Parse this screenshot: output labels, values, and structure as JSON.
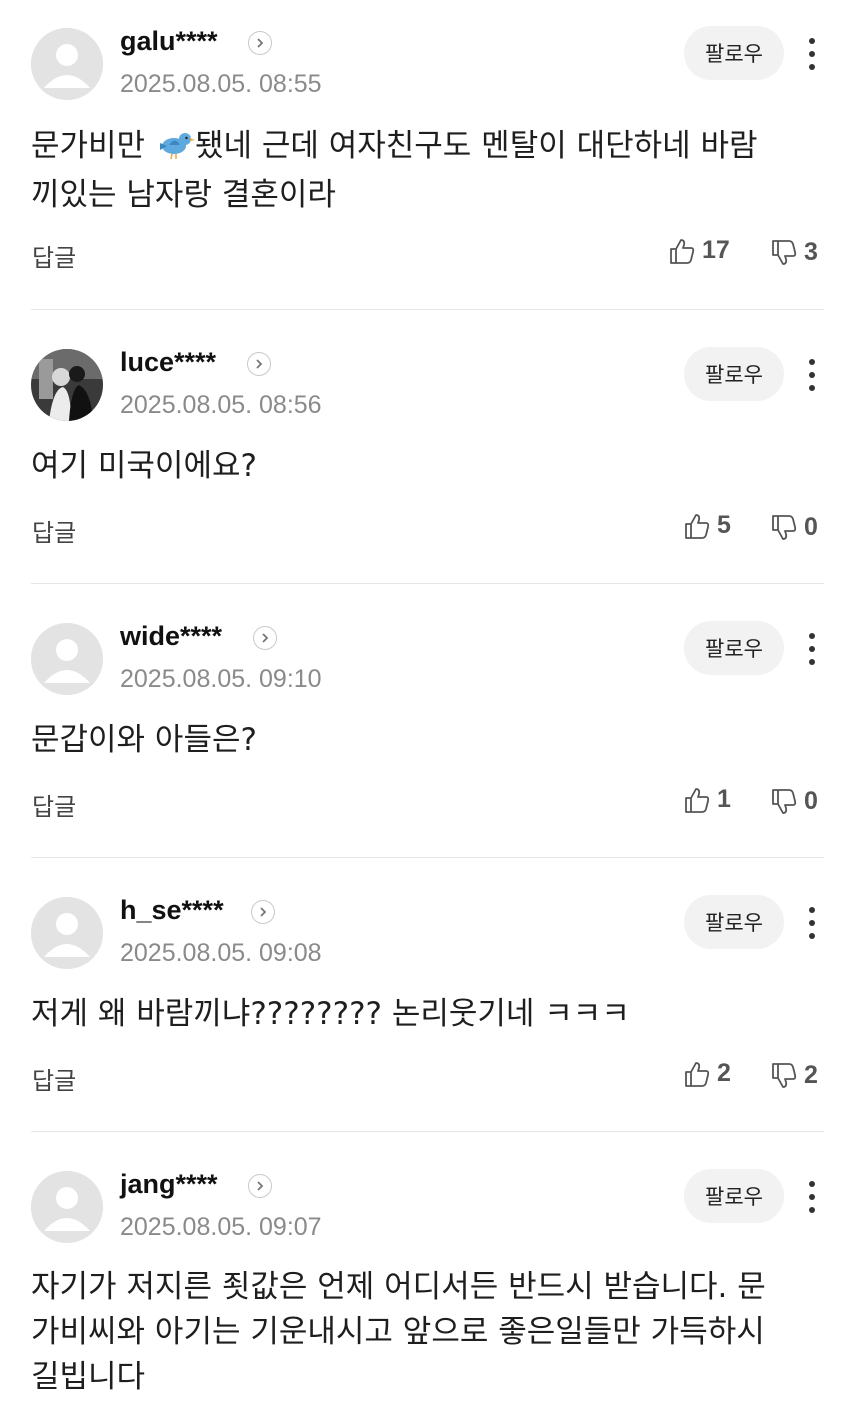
{
  "colors": {
    "follow_bg": "#f2f2f2",
    "divider": "#e6e6e6",
    "meta_text": "#8a8a8a"
  },
  "comments": [
    {
      "username": "galu****",
      "timestamp": "2025.08.05. 08:55",
      "text_part1": "문가비만 ",
      "emoji": "bird-icon",
      "text_part2": "됐네 근데 여자친구도 멘탈이 대단하네 바람끼있는 남자랑 결혼이라",
      "follow_label": "팔로우",
      "reply_label": "답글",
      "likes": "17",
      "dislikes": "3",
      "avatar": "default-avatar"
    },
    {
      "username": "luce****",
      "timestamp": "2025.08.05. 08:56",
      "text": "여기 미국이에요?",
      "follow_label": "팔로우",
      "reply_label": "답글",
      "likes": "5",
      "dislikes": "0",
      "avatar": "photo-avatar"
    },
    {
      "username": "wide****",
      "timestamp": "2025.08.05. 09:10",
      "text": "문갑이와 아들은?",
      "follow_label": "팔로우",
      "reply_label": "답글",
      "likes": "1",
      "dislikes": "0",
      "avatar": "default-avatar"
    },
    {
      "username": "h_se****",
      "timestamp": "2025.08.05. 09:08",
      "text": "저게 왜 바람끼냐???????? 논리웃기네 ㅋㅋㅋ",
      "follow_label": "팔로우",
      "reply_label": "답글",
      "likes": "2",
      "dislikes": "2",
      "avatar": "default-avatar"
    },
    {
      "username": "jang****",
      "timestamp": "2025.08.05. 09:07",
      "text": "자기가 저지른 죗값은 언제 어디서든 반드시 받습니다. 문가비씨와 아기는 기운내시고 앞으로 좋은일들만 가득하시길빕니다",
      "follow_label": "팔로우",
      "avatar": "default-avatar"
    }
  ]
}
